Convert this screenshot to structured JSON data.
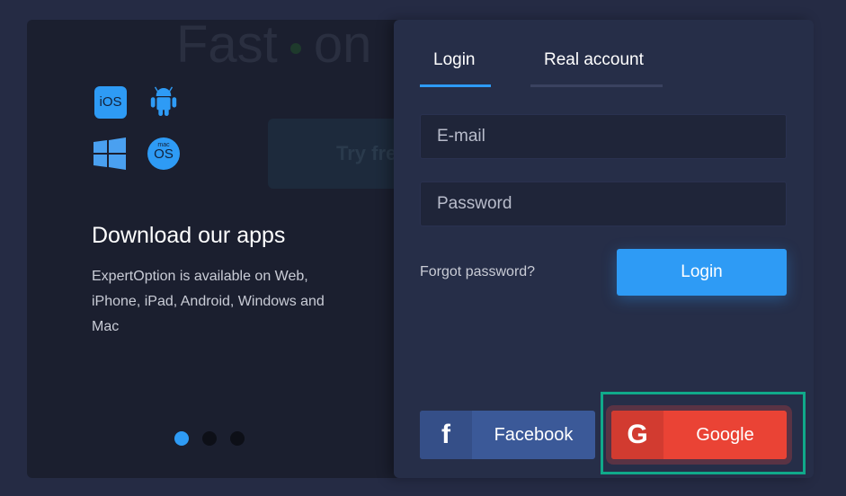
{
  "background": {
    "title_word1": "Fast",
    "title_word2": "on",
    "try_button": "Try fre"
  },
  "promo": {
    "ios_label": "iOS",
    "mac_top": "mac",
    "mac_label": "OS",
    "heading": "Download our apps",
    "text": "ExpertOption is available on Web, iPhone, iPad, Android, Windows and Mac",
    "active_slide": 1,
    "slides": 3
  },
  "tabs": [
    {
      "label": "Login",
      "active": true
    },
    {
      "label": "Real account",
      "active": false
    }
  ],
  "form": {
    "email_placeholder": "E-mail",
    "password_placeholder": "Password",
    "forgot": "Forgot password?",
    "login": "Login"
  },
  "social": {
    "facebook": "Facebook",
    "facebook_icon": "f",
    "google": "Google",
    "google_icon": "G"
  },
  "colors": {
    "accent": "#2e9bf5",
    "facebook": "#3b5998",
    "google": "#ea4335",
    "highlight": "#10a98a"
  }
}
